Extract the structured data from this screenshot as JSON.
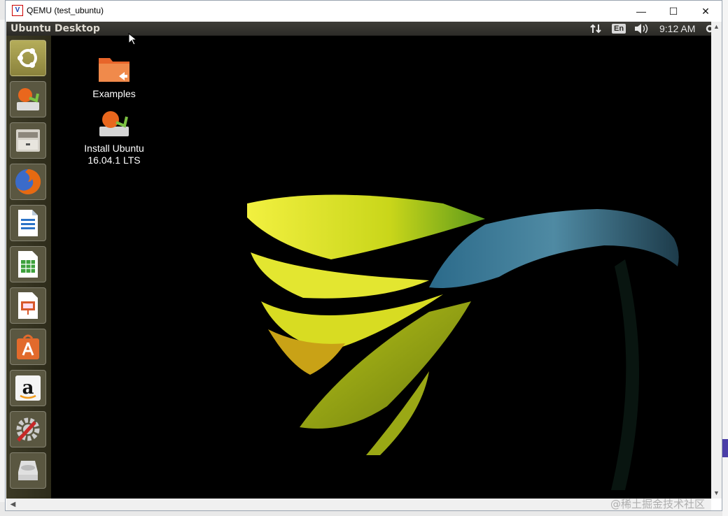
{
  "window": {
    "icon_text": "V",
    "title": "QEMU (test_ubuntu)",
    "minimize": "—",
    "maximize": "☐",
    "close": "✕"
  },
  "panel": {
    "title": "Ubuntu Desktop",
    "language": "En",
    "time": "9:12 AM"
  },
  "launcher": {
    "items": [
      {
        "name": "dash-home"
      },
      {
        "name": "install-ubuntu"
      },
      {
        "name": "files"
      },
      {
        "name": "firefox"
      },
      {
        "name": "libreoffice-writer"
      },
      {
        "name": "libreoffice-calc"
      },
      {
        "name": "libreoffice-impress"
      },
      {
        "name": "ubuntu-software"
      },
      {
        "name": "amazon"
      },
      {
        "name": "system-settings"
      },
      {
        "name": "disk"
      }
    ]
  },
  "desktop": {
    "examples_label": "Examples",
    "install_label_1": "Install Ubuntu",
    "install_label_2": "16.04.1 LTS"
  },
  "watermark": "@稀土掘金技术社区",
  "colors": {
    "launcher_bg": "#3c3a26",
    "panel_bg": "#3e3d38",
    "flower_yellow": "#d7e21a",
    "flower_stem": "#3f6e82"
  }
}
